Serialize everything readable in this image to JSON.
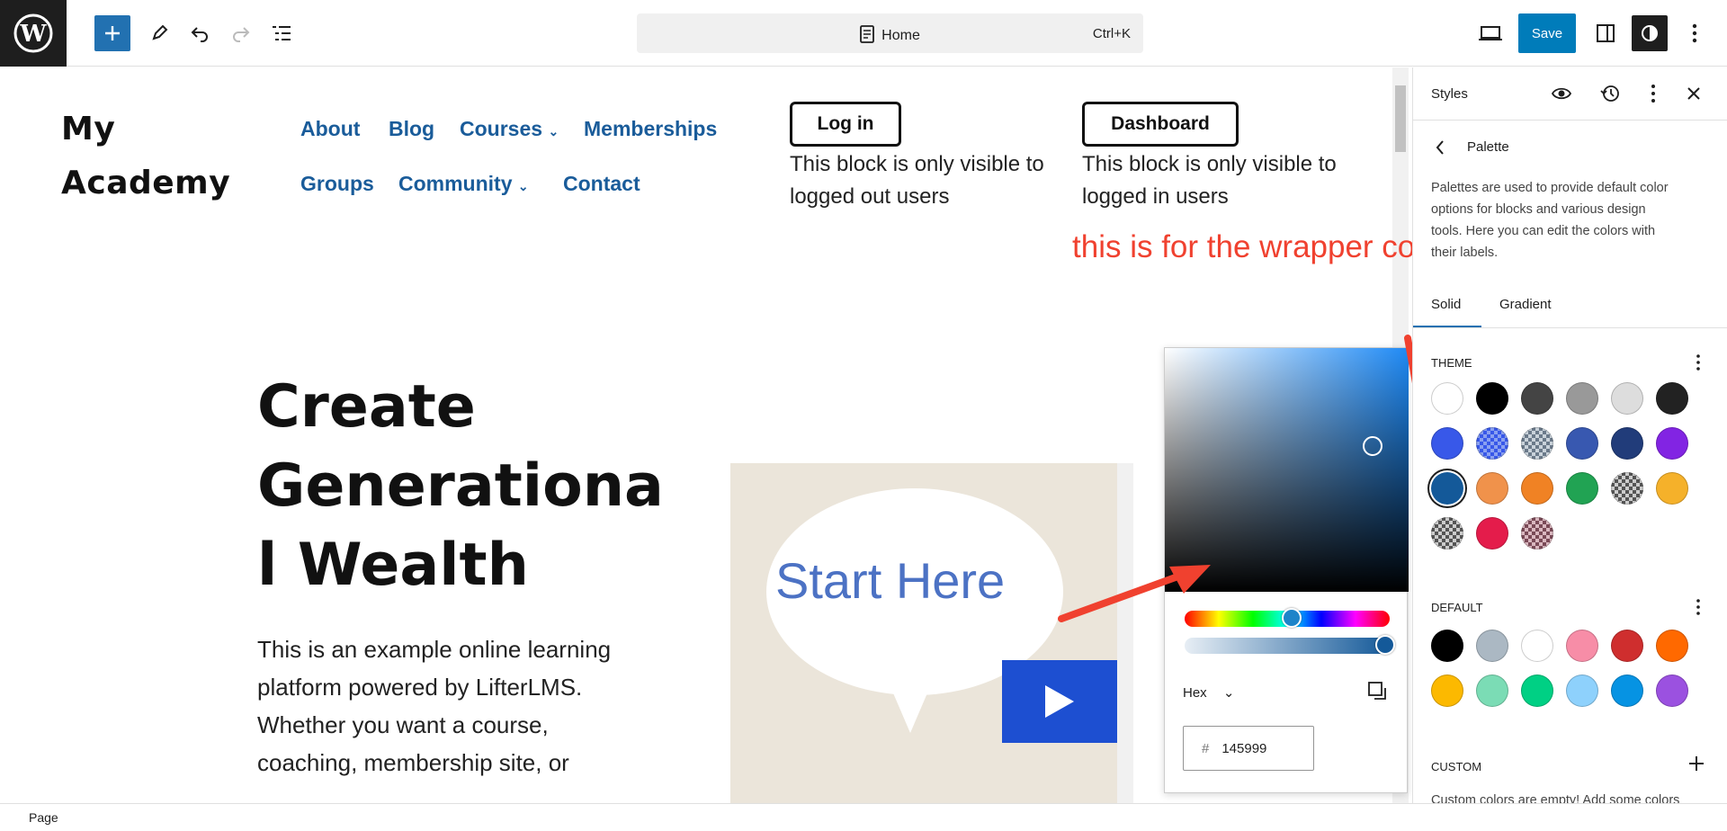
{
  "topbar": {
    "document_title": "Home",
    "shortcut": "Ctrl+K",
    "save_label": "Save"
  },
  "site": {
    "title_line1": "My",
    "title_line2": "Academy",
    "nav_row1": [
      "About",
      "Blog",
      "Courses",
      "Memberships"
    ],
    "nav_row2": [
      "Groups",
      "Community",
      "Contact"
    ],
    "login_button": "Log in",
    "login_note_line1": "This block is only visible to",
    "login_note_line2": "logged out users",
    "dashboard_button": "Dashboard",
    "dashboard_note_line1": "This block is only visible to",
    "dashboard_note_line2": "logged in users"
  },
  "annotation": "this is for the wrapper color",
  "hero": {
    "line1": "Create",
    "line2": "Generationa",
    "line3": "l Wealth",
    "para_lines": [
      "This is an example online learning",
      "platform powered by LifterLMS.",
      "Whether you want a course,",
      "coaching, membership site, or"
    ]
  },
  "video": {
    "caption": "Start Here"
  },
  "picker": {
    "format_label": "Hex",
    "hash": "#",
    "hex_value": "145999",
    "hue_color": "#1f8af5",
    "selected_color": "#145999"
  },
  "sidebar": {
    "title": "Styles",
    "back_title": "Palette",
    "description_lines": [
      "Palettes are used to provide default color",
      "options for blocks and various design",
      "tools. Here you can edit the colors with",
      "their labels."
    ],
    "tab_solid": "Solid",
    "tab_gradient": "Gradient",
    "theme_heading": "THEME",
    "theme_colors": [
      "#ffffff",
      "#000000",
      "#444444",
      "#999999",
      "#dddddd",
      "#222222",
      "#3858e9",
      "checker-blue",
      "checker-grey",
      "#3858b0",
      "#213c7a",
      "#8224e3",
      "#145999",
      "#f0924b",
      "#f08224",
      "#21a353",
      "checker-dark",
      "#f5b12a",
      "checker-dark",
      "#e41c4b",
      "checker-rose"
    ],
    "default_heading": "DEFAULT",
    "default_colors": [
      "#000000",
      "#abb8c3",
      "#ffffff",
      "#f78da7",
      "#cf2e2e",
      "#ff6900",
      "#fcb900",
      "#7bdcb5",
      "#00d084",
      "#8ed1fc",
      "#0693e3",
      "#9b51e0"
    ],
    "custom_heading": "CUSTOM",
    "custom_note": "Custom colors are empty! Add some colors"
  },
  "status": {
    "breadcrumb": "Page"
  }
}
